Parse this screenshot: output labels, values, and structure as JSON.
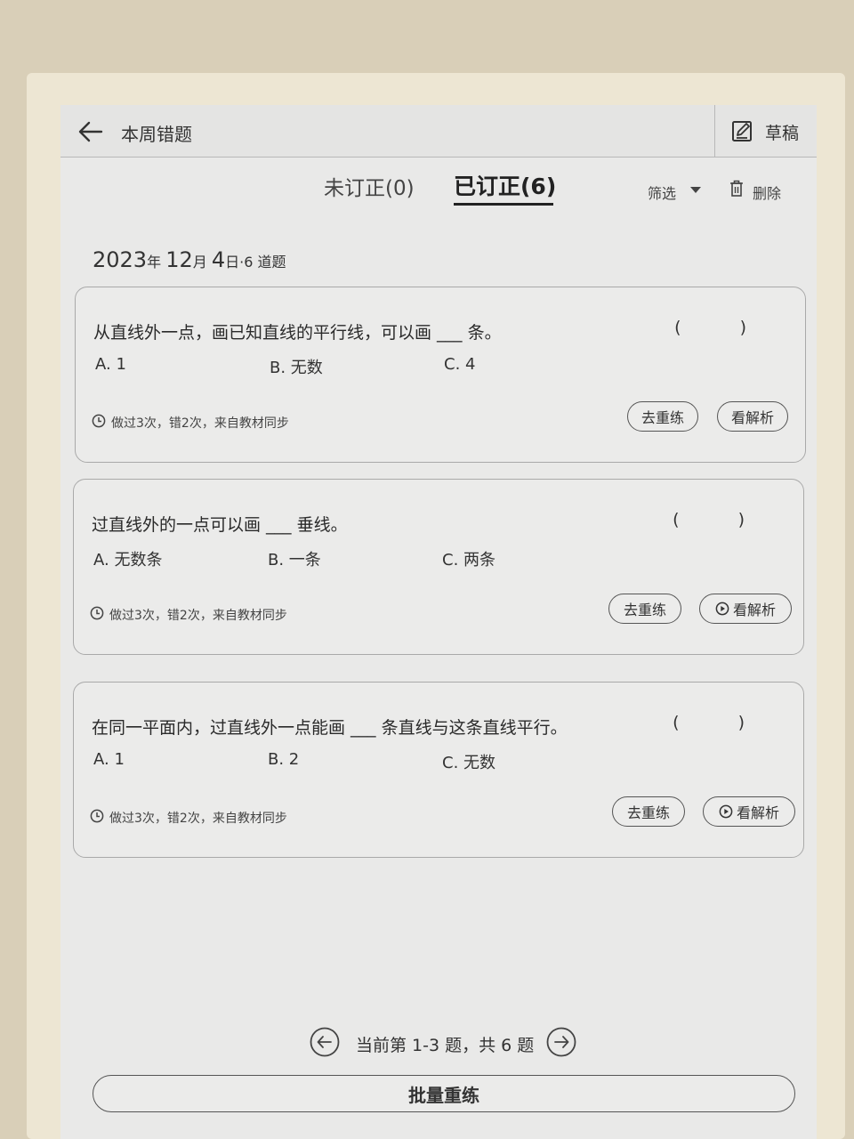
{
  "header": {
    "title": "本周错题",
    "draft_label": "草稿"
  },
  "tabs": [
    {
      "label": "未订正(0)",
      "active": false
    },
    {
      "label": "已订正(6)",
      "active": true
    }
  ],
  "toolbar": {
    "filter_label": "筛选",
    "delete_label": "删除"
  },
  "date_group": {
    "year": "2023",
    "year_unit": "年",
    "month": "12",
    "month_unit": "月",
    "day": "4",
    "day_unit": "日",
    "count_text": "·6 道题"
  },
  "questions": [
    {
      "text": "从直线外一点，画已知直线的平行线，可以画 ___ 条。",
      "parens": "( )",
      "options": [
        "A. 1",
        "B. 无数",
        "C. 4"
      ],
      "meta": "做过3次，错2次，来自教材同步",
      "retry_label": "去重练",
      "analysis_label": "看解析"
    },
    {
      "text": "过直线外的一点可以画 ___ 垂线。",
      "parens": "( )",
      "options": [
        "A. 无数条",
        "B. 一条",
        "C. 两条"
      ],
      "meta": "做过3次，错2次，来自教材同步",
      "retry_label": "去重练",
      "analysis_label": "看解析"
    },
    {
      "text": "在同一平面内，过直线外一点能画 ___ 条直线与这条直线平行。",
      "parens": "( )",
      "options": [
        "A. 1",
        "B. 2",
        "C. 无数"
      ],
      "meta": "做过3次，错2次，来自教材同步",
      "retry_label": "去重练",
      "analysis_label": "看解析"
    }
  ],
  "pager": {
    "text": "当前第 1-3 题，共 6 题"
  },
  "batch_button": "批量重练",
  "icons": {
    "back": "arrow-left-icon",
    "draft": "edit-note-icon",
    "delete": "trash-icon",
    "clock": "clock-icon",
    "play": "play-circle-icon",
    "prev": "circle-arrow-left-icon",
    "next": "circle-arrow-right-icon"
  }
}
